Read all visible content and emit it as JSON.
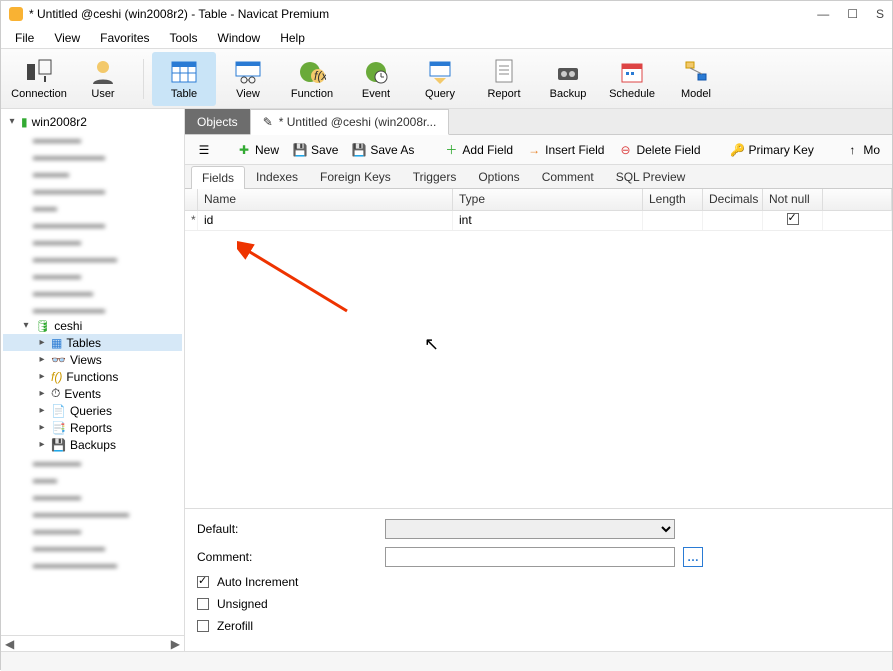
{
  "title": "* Untitled @ceshi (win2008r2) - Table - Navicat Premium",
  "menu": {
    "file": "File",
    "view": "View",
    "favorites": "Favorites",
    "tools": "Tools",
    "window": "Window",
    "help": "Help"
  },
  "toolbar": {
    "connection": "Connection",
    "user": "User",
    "table": "Table",
    "view": "View",
    "function": "Function",
    "event": "Event",
    "query": "Query",
    "report": "Report",
    "backup": "Backup",
    "schedule": "Schedule",
    "model": "Model"
  },
  "tree": {
    "root": "win2008r2",
    "db": "ceshi",
    "nodes": {
      "tables": "Tables",
      "views": "Views",
      "functions": "Functions",
      "events": "Events",
      "queries": "Queries",
      "reports": "Reports",
      "backups": "Backups"
    }
  },
  "tabs": {
    "objects": "Objects",
    "doc": "* Untitled @ceshi (win2008r..."
  },
  "actions": {
    "new": "New",
    "save": "Save",
    "saveas": "Save As",
    "addfield": "Add Field",
    "insertfield": "Insert Field",
    "deletefield": "Delete Field",
    "primarykey": "Primary Key",
    "mo": "Mo"
  },
  "subtabs": {
    "fields": "Fields",
    "indexes": "Indexes",
    "fkeys": "Foreign Keys",
    "triggers": "Triggers",
    "options": "Options",
    "comment": "Comment",
    "sqlpreview": "SQL Preview"
  },
  "grid": {
    "headers": {
      "name": "Name",
      "type": "Type",
      "length": "Length",
      "decimals": "Decimals",
      "notnull": "Not null"
    },
    "rows": [
      {
        "mark": "*",
        "name": "id",
        "type": "int",
        "length": "",
        "decimals": "",
        "notnull": true
      }
    ]
  },
  "props": {
    "default_lbl": "Default:",
    "default_val": "",
    "comment_lbl": "Comment:",
    "comment_val": "",
    "autoinc": "Auto Increment",
    "autoinc_checked": true,
    "unsigned": "Unsigned",
    "unsigned_checked": false,
    "zerofill": "Zerofill",
    "zerofill_checked": false
  }
}
